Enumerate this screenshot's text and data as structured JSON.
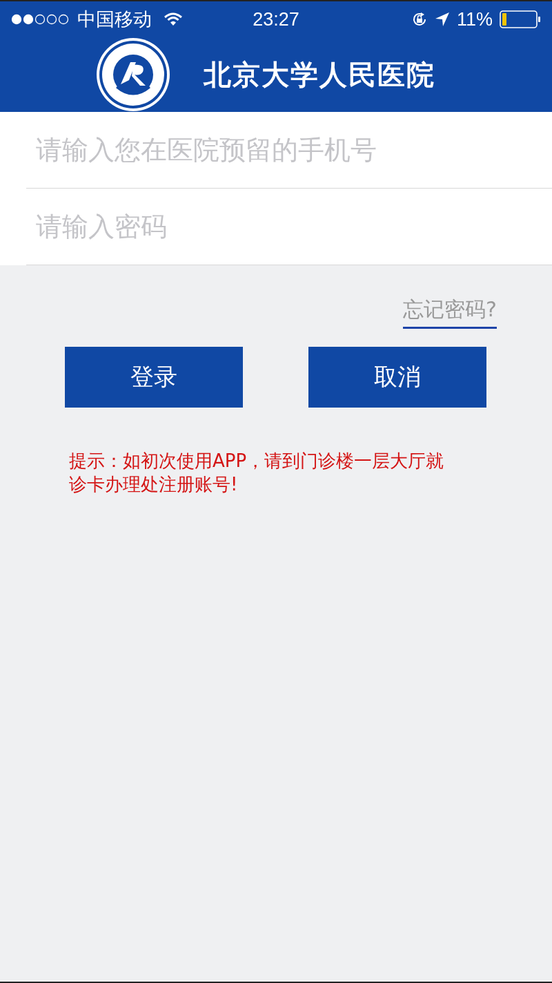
{
  "status_bar": {
    "carrier": "中国移动",
    "time": "23:27",
    "battery": "11%"
  },
  "header": {
    "title": "北京大学人民医院"
  },
  "fields": [
    {
      "placeholder": "请输入您在医院预留的手机号"
    },
    {
      "placeholder": "请输入密码"
    }
  ],
  "forgot_link": "忘记密码?",
  "buttons": [
    "登录",
    "取消"
  ],
  "hint": "提示：如初次使用APP，请到门诊楼一层大厅就诊卡办理处注册账号!"
}
